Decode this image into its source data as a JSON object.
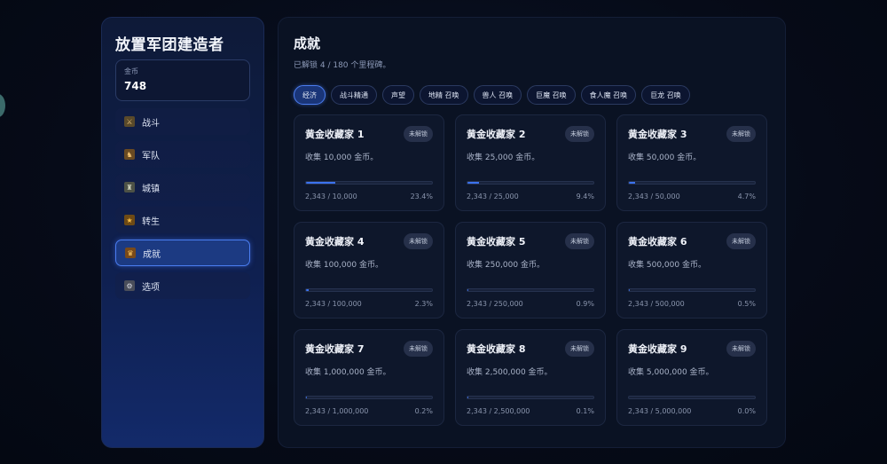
{
  "app": {
    "title": "放置军团建造者"
  },
  "gold": {
    "label": "金币",
    "value": "748"
  },
  "nav": [
    {
      "label": "战斗",
      "icon": "crossed-swords-icon",
      "color": "#c9a35a",
      "active": false
    },
    {
      "label": "军队",
      "icon": "soldier-icon",
      "color": "#b88a44",
      "active": false
    },
    {
      "label": "城镇",
      "icon": "castle-icon",
      "color": "#8a8f7a",
      "active": false
    },
    {
      "label": "转生",
      "icon": "star-icon",
      "color": "#e3a63a",
      "active": false
    },
    {
      "label": "成就",
      "icon": "trophy-icon",
      "color": "#d08c3a",
      "active": true
    },
    {
      "label": "选项",
      "icon": "gear-icon",
      "color": "#a2a6b4",
      "active": false
    }
  ],
  "main": {
    "title": "成就",
    "subtitle": "已解锁 4 / 180 个里程碑。",
    "tabs": [
      {
        "label": "经济",
        "active": true
      },
      {
        "label": "战斗精通",
        "active": false
      },
      {
        "label": "声望",
        "active": false
      },
      {
        "label": "地精 召唤",
        "active": false
      },
      {
        "label": "兽人 召唤",
        "active": false
      },
      {
        "label": "巨魔 召唤",
        "active": false
      },
      {
        "label": "食人魔 召唤",
        "active": false
      },
      {
        "label": "巨龙 召唤",
        "active": false
      }
    ],
    "cards": [
      {
        "title": "黄金收藏家 1",
        "badge": "未解锁",
        "desc": "收集 10,000 金币。",
        "progress": "2,343 / 10,000",
        "percent": "23.4%",
        "fill": 23.4
      },
      {
        "title": "黄金收藏家 2",
        "badge": "未解锁",
        "desc": "收集 25,000 金币。",
        "progress": "2,343 / 25,000",
        "percent": "9.4%",
        "fill": 9.4
      },
      {
        "title": "黄金收藏家 3",
        "badge": "未解锁",
        "desc": "收集 50,000 金币。",
        "progress": "2,343 / 50,000",
        "percent": "4.7%",
        "fill": 4.7
      },
      {
        "title": "黄金收藏家 4",
        "badge": "未解锁",
        "desc": "收集 100,000 金币。",
        "progress": "2,343 / 100,000",
        "percent": "2.3%",
        "fill": 2.3
      },
      {
        "title": "黄金收藏家 5",
        "badge": "未解锁",
        "desc": "收集 250,000 金币。",
        "progress": "2,343 / 250,000",
        "percent": "0.9%",
        "fill": 0.9
      },
      {
        "title": "黄金收藏家 6",
        "badge": "未解锁",
        "desc": "收集 500,000 金币。",
        "progress": "2,343 / 500,000",
        "percent": "0.5%",
        "fill": 0.5
      },
      {
        "title": "黄金收藏家 7",
        "badge": "未解锁",
        "desc": "收集 1,000,000 金币。",
        "progress": "2,343 / 1,000,000",
        "percent": "0.2%",
        "fill": 0.2
      },
      {
        "title": "黄金收藏家 8",
        "badge": "未解锁",
        "desc": "收集 2,500,000 金币。",
        "progress": "2,343 / 2,500,000",
        "percent": "0.1%",
        "fill": 0.1
      },
      {
        "title": "黄金收藏家 9",
        "badge": "未解锁",
        "desc": "收集 5,000,000 金币。",
        "progress": "2,343 / 5,000,000",
        "percent": "0.0%",
        "fill": 0.0
      }
    ]
  }
}
